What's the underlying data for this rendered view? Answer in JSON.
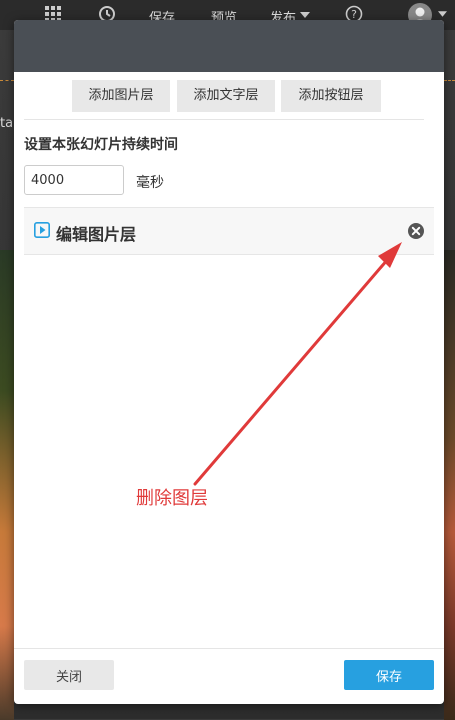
{
  "topbar": {
    "save_label": "保存",
    "preview_label": "预览",
    "publish_label": "发布"
  },
  "background": {
    "peek_text": "ta"
  },
  "modal": {
    "layer_buttons": [
      {
        "label": "添加图片层"
      },
      {
        "label": "添加文字层"
      },
      {
        "label": "添加按钮层"
      }
    ],
    "duration_label": "设置本张幻灯片持续时间",
    "duration_value": "4000",
    "duration_unit": "毫秒",
    "layer_title": "编辑图片层",
    "annotation": "删除图层",
    "footer": {
      "close_label": "关闭",
      "save_label": "保存"
    }
  },
  "colors": {
    "header": "#4a4f55",
    "primary": "#27a0e0",
    "annotation": "#e03a3a"
  }
}
